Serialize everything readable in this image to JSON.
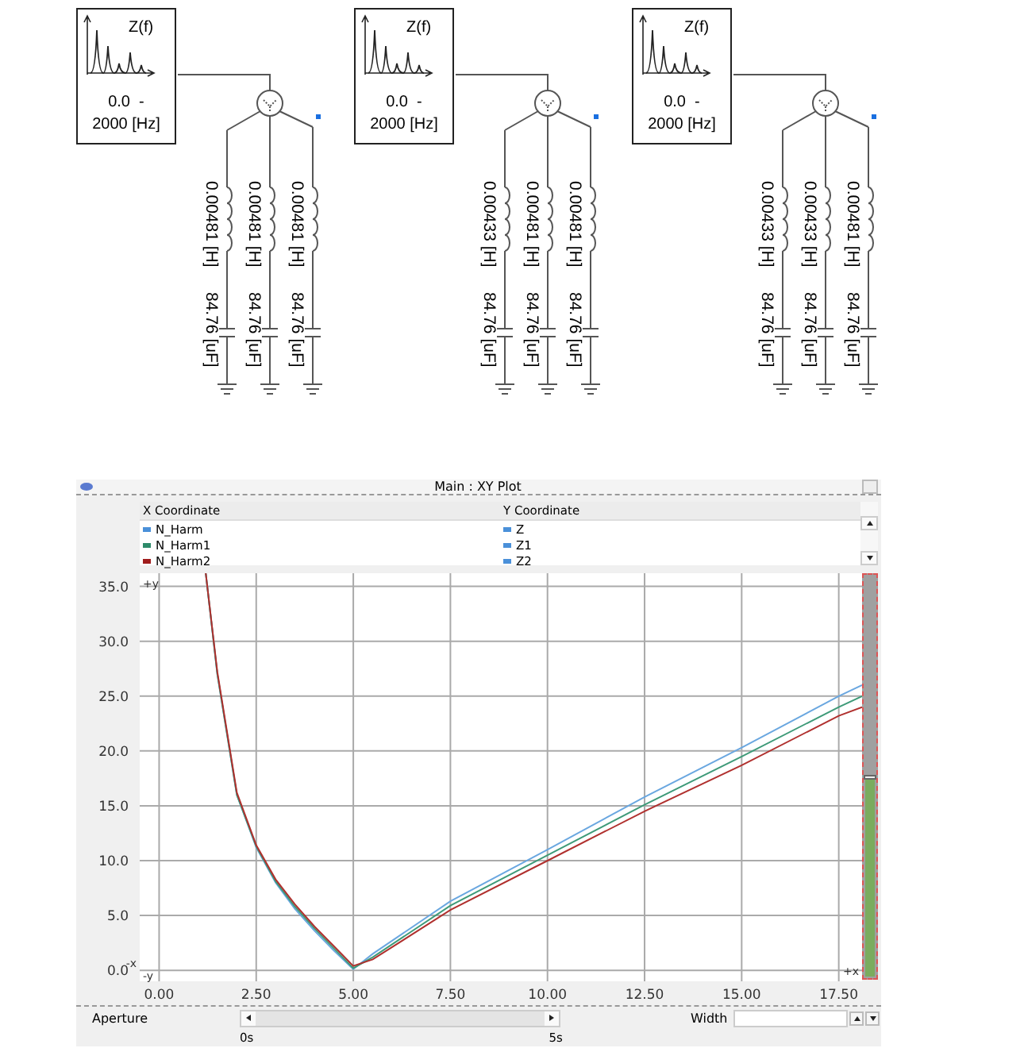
{
  "circuits": [
    {
      "meter": {
        "title": "Z(f)",
        "range_start": "0.0  -",
        "range_end": "2000 [Hz]"
      },
      "branches": [
        {
          "inductance": "0.00481 [H]",
          "capacitance": "84.76 [uF]"
        },
        {
          "inductance": "0.00481 [H]",
          "capacitance": "84.76 [uF]"
        },
        {
          "inductance": "0.00481 [H]",
          "capacitance": "84.76 [uF]"
        }
      ]
    },
    {
      "meter": {
        "title": "Z(f)",
        "range_start": "0.0  -",
        "range_end": "2000 [Hz]"
      },
      "branches": [
        {
          "inductance": "0.00433 [H]",
          "capacitance": "84.76 [uF]"
        },
        {
          "inductance": "0.00481 [H]",
          "capacitance": "84.76 [uF]"
        },
        {
          "inductance": "0.00481 [H]",
          "capacitance": "84.76 [uF]"
        }
      ]
    },
    {
      "meter": {
        "title": "Z(f)",
        "range_start": "0.0  -",
        "range_end": "2000 [Hz]"
      },
      "branches": [
        {
          "inductance": "0.00433 [H]",
          "capacitance": "84.76 [uF]"
        },
        {
          "inductance": "0.00433 [H]",
          "capacitance": "84.76 [uF]"
        },
        {
          "inductance": "0.00481 [H]",
          "capacitance": "84.76 [uF]"
        }
      ]
    }
  ],
  "plot_window": {
    "title": "Main : XY Plot",
    "legend": {
      "x_header": "X Coordinate",
      "y_header": "Y Coordinate",
      "rows": [
        {
          "x": "N_Harm",
          "color": "#4a90d9"
        },
        {
          "x": "N_Harm1",
          "color": "#2e8b6a"
        },
        {
          "x": "N_Harm2",
          "color": "#a01c1c"
        }
      ]
    },
    "axis_markers": [
      "+y",
      "-x",
      "-y",
      "+x"
    ],
    "chart_data": {
      "type": "line",
      "grid": true,
      "x": [
        1.2,
        1.5,
        2,
        2.5,
        3,
        3.5,
        4,
        4.5,
        5,
        5.5,
        7.5,
        10,
        12.5,
        15,
        17.5,
        18.1
      ],
      "series": [
        {
          "name": "Z",
          "color": "#6aa7e0",
          "values": [
            36.2,
            27,
            16,
            11.2,
            8,
            5.6,
            3.6,
            1.8,
            0.1,
            1.5,
            6.3,
            11,
            15.8,
            20.3,
            25,
            26
          ]
        },
        {
          "name": "Z1",
          "color": "#3e9a78",
          "values": [
            36.2,
            27,
            16,
            11.3,
            8.1,
            5.8,
            3.8,
            2,
            0.2,
            1.2,
            5.9,
            10.5,
            15.1,
            19.5,
            24,
            25
          ]
        },
        {
          "name": "Z2",
          "color": "#b0302e",
          "values": [
            36.2,
            27.2,
            16.2,
            11.4,
            8.3,
            6,
            4,
            2.2,
            0.4,
            1,
            5.5,
            10,
            14.5,
            18.7,
            23.2,
            24
          ]
        }
      ],
      "xlim": [
        -0.5,
        18.1
      ],
      "ylim": [
        -1,
        36.2
      ],
      "xticks": [
        {
          "value": 0,
          "label": "0.00"
        },
        {
          "value": 2.5,
          "label": "2.50"
        },
        {
          "value": 5,
          "label": "5.00"
        },
        {
          "value": 7.5,
          "label": "7.50"
        },
        {
          "value": 10,
          "label": "10.00"
        },
        {
          "value": 12.5,
          "label": "12.50"
        },
        {
          "value": 15,
          "label": "15.00"
        },
        {
          "value": 17.5,
          "label": "17.50"
        }
      ],
      "yticks": [
        {
          "value": 0,
          "label": "0.0"
        },
        {
          "value": 5,
          "label": "5.0"
        },
        {
          "value": 10,
          "label": "10.0"
        },
        {
          "value": 15,
          "label": "15.0"
        },
        {
          "value": 20,
          "label": "20.0"
        },
        {
          "value": 25,
          "label": "25.0"
        },
        {
          "value": 30,
          "label": "30.0"
        },
        {
          "value": 35,
          "label": "35.0"
        }
      ]
    },
    "zoom_slider": {
      "level": 0.5
    },
    "aperture": {
      "label": "Aperture",
      "start": "0s",
      "end": "5s"
    },
    "width": {
      "label": "Width"
    }
  }
}
